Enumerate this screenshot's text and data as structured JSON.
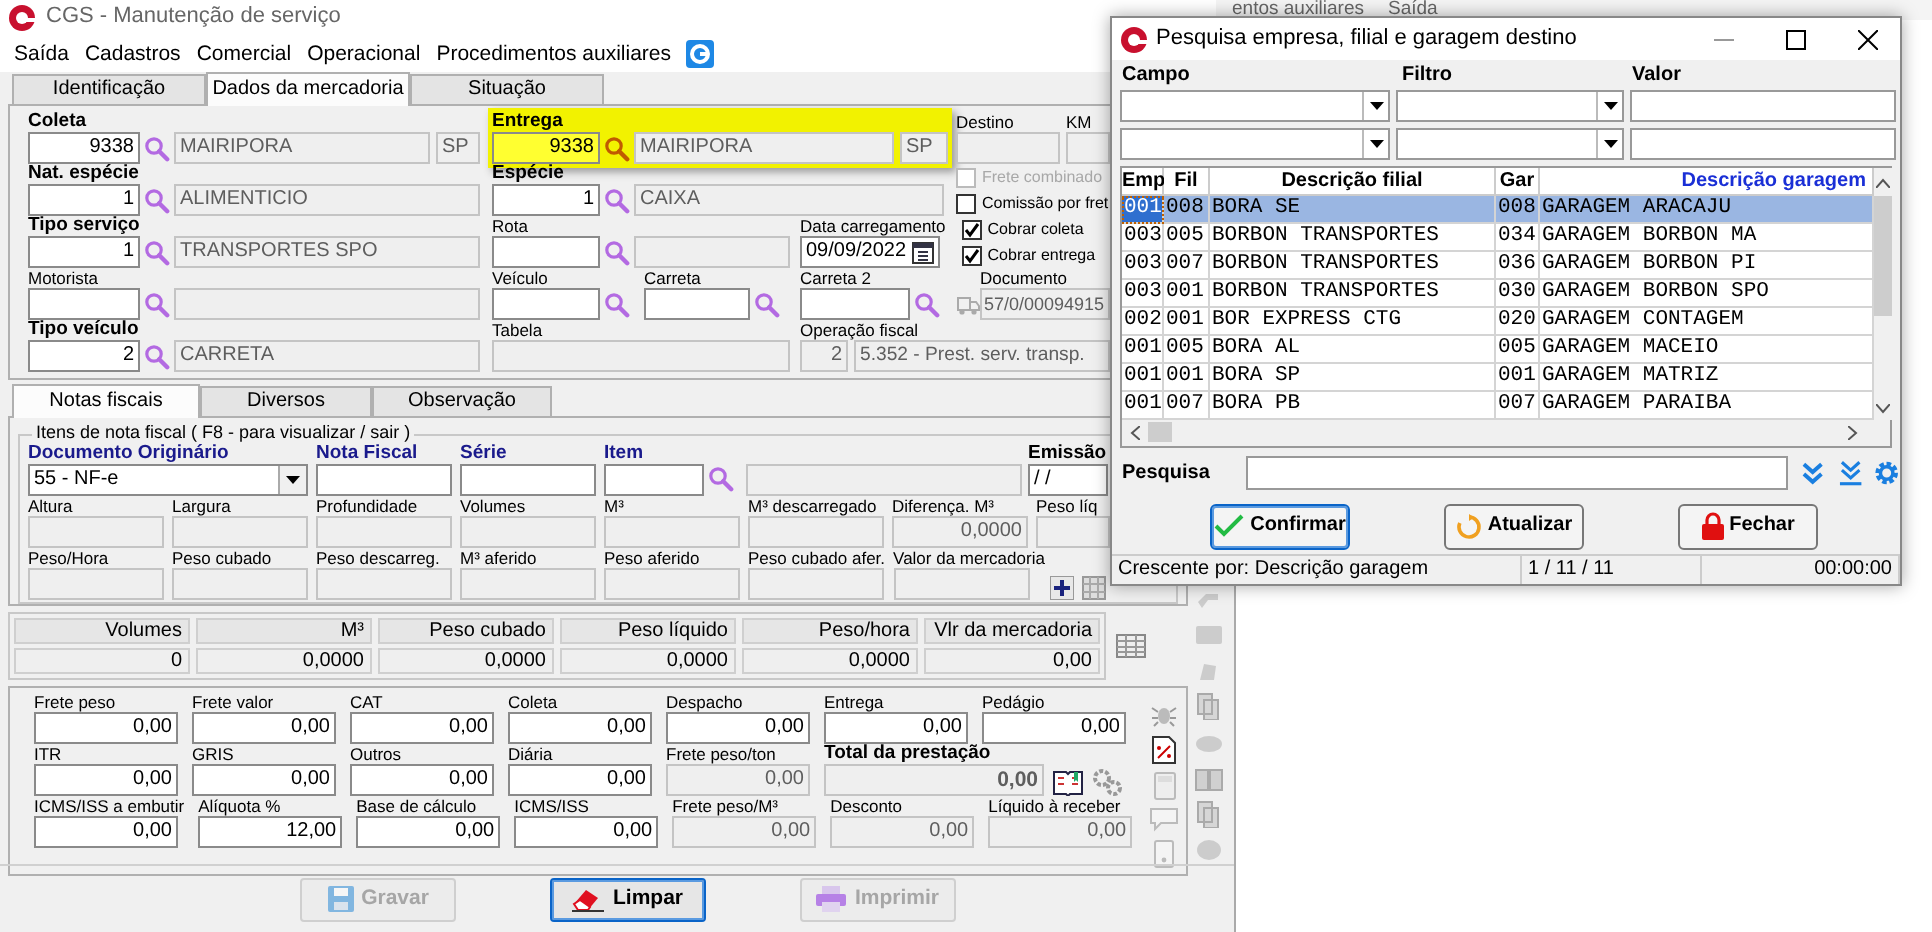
{
  "background_window": {
    "menu": [
      "entos auxiliares",
      "Saída"
    ]
  },
  "window": {
    "title": "CGS - Manutenção de serviço"
  },
  "menu": [
    "Saída",
    "Cadastros",
    "Comercial",
    "Operacional",
    "Procedimentos auxiliares"
  ],
  "tabs": [
    {
      "label": "Identificação",
      "selected": false
    },
    {
      "label": "Dados da mercadoria",
      "selected": true
    },
    {
      "label": "Situação",
      "selected": false
    }
  ],
  "header_form": {
    "rows": [
      {
        "fields": [
          {
            "kind": "lookup",
            "label": "Coleta",
            "label_bold": true,
            "highlighted": false,
            "inputs": [
              {
                "value": "9338",
                "disabled": false
              },
              {
                "value": "MAIRIPORA",
                "disabled": true
              },
              {
                "value": "SP",
                "disabled": true
              }
            ]
          },
          {
            "kind": "lookup",
            "label": "Entrega",
            "label_bold": true,
            "highlighted": true,
            "inputs": [
              {
                "value": "9338",
                "disabled": false
              },
              {
                "value": "MAIRIPORA",
                "disabled": true
              },
              {
                "value": "SP",
                "disabled": true
              }
            ]
          },
          {
            "kind": "input",
            "label": "Destino",
            "label_bold": false,
            "highlighted": false,
            "inputs": [
              {
                "disabled": true
              }
            ]
          },
          {
            "kind": "input",
            "label": "KM",
            "label_bold": false,
            "highlighted": false,
            "inputs": [
              {
                "disabled": true
              }
            ]
          }
        ]
      },
      {
        "fields": [
          {
            "kind": "lookup",
            "label": "Nat. espécie",
            "label_bold": true,
            "highlighted": false,
            "inputs": [
              {
                "value": "1",
                "disabled": false
              },
              {
                "value": "ALIMENTICIO",
                "disabled": true
              }
            ]
          },
          {
            "kind": "lookup",
            "label": "Espécie",
            "label_bold": true,
            "highlighted": false,
            "inputs": [
              {
                "value": "1",
                "disabled": false
              },
              {
                "value": "CAIXA",
                "disabled": true
              }
            ]
          },
          {
            "kind": "checks",
            "items": [
              {
                "label": "Frete combinado",
                "checked": false,
                "disabled": true
              },
              {
                "label": "Comissão por fret",
                "checked": false,
                "disabled": false
              }
            ]
          }
        ]
      },
      {
        "fields": [
          {
            "kind": "lookup",
            "label": "Tipo serviço",
            "label_bold": true,
            "highlighted": false,
            "inputs": [
              {
                "value": "1",
                "disabled": false
              },
              {
                "value": "TRANSPORTES SPO",
                "disabled": true
              }
            ]
          },
          {
            "kind": "lookup",
            "label": "Rota",
            "label_bold": false,
            "highlighted": false,
            "inputs": [
              {
                "disabled": false
              },
              {
                "disabled": true
              }
            ]
          },
          {
            "kind": "date",
            "label": "Data carregamento",
            "label_bold": false,
            "highlighted": false,
            "inputs": [
              {
                "value": "09/09/2022",
                "disabled": false
              }
            ]
          },
          {
            "kind": "checks",
            "items": [
              {
                "label": "Cobrar coleta",
                "checked": true,
                "disabled": false
              },
              {
                "label": "Cobrar entrega",
                "checked": true,
                "disabled": false
              }
            ]
          }
        ]
      },
      {
        "fields": [
          {
            "kind": "lookup",
            "label": "Motorista",
            "label_bold": false,
            "highlighted": false,
            "inputs": [
              {
                "disabled": false
              },
              {
                "disabled": true
              }
            ]
          },
          {
            "kind": "lookup",
            "label": "Veículo",
            "label_bold": false,
            "highlighted": false,
            "inputs": [
              {
                "disabled": false
              }
            ]
          },
          {
            "kind": "lookup",
            "label": "Carreta",
            "label_bold": false,
            "highlighted": false,
            "inputs": [
              {
                "disabled": false
              }
            ]
          },
          {
            "kind": "lookup",
            "label": "Carreta 2",
            "label_bold": false,
            "highlighted": false,
            "inputs": [
              {
                "disabled": false
              }
            ]
          },
          {
            "kind": "document",
            "label": "Documento",
            "label_bold": false,
            "highlighted": false,
            "inputs": [
              {
                "value": "57/0/00094915",
                "disabled": true
              }
            ]
          }
        ]
      },
      {
        "fields": [
          {
            "kind": "lookup",
            "label": "Tipo veículo",
            "label_bold": true,
            "highlighted": false,
            "inputs": [
              {
                "value": "2",
                "disabled": false
              },
              {
                "value": "CARRETA",
                "disabled": true
              }
            ]
          },
          {
            "kind": "input",
            "label": "Tabela",
            "label_bold": false,
            "highlighted": false,
            "inputs": [
              {
                "disabled": true
              }
            ]
          },
          {
            "kind": "input",
            "label": "Operação fiscal",
            "label_bold": false,
            "highlighted": false,
            "inputs": [
              {
                "value": "2",
                "disabled": true
              },
              {
                "value": "5.352 - Prest. serv. transp.",
                "disabled": true
              }
            ]
          }
        ]
      }
    ]
  },
  "item_tabs": [
    {
      "label": "Notas fiscais",
      "selected": true
    },
    {
      "label": "Diversos",
      "selected": false
    },
    {
      "label": "Observação",
      "selected": false
    }
  ],
  "items_group": {
    "title": "Itens de nota fiscal ( F8 - para visualizar / sair )",
    "rows": [
      {
        "fields": [
          {
            "kind": "select",
            "label": "Documento Originário",
            "label_bold": true,
            "label_accent": true,
            "inputs": [
              {
                "value": "55 - NF-e",
                "disabled": false
              }
            ]
          },
          {
            "kind": "input",
            "label": "Nota Fiscal",
            "label_bold": true,
            "label_accent": true,
            "inputs": [
              {
                "disabled": false
              }
            ]
          },
          {
            "kind": "input",
            "label": "Série",
            "label_bold": true,
            "label_accent": true,
            "inputs": [
              {
                "disabled": false
              }
            ]
          },
          {
            "kind": "lookup",
            "label": "Item",
            "label_bold": true,
            "label_accent": true,
            "inputs": [
              {
                "disabled": false
              }
            ]
          },
          {
            "kind": "input",
            "inputs": [
              {
                "disabled": true
              }
            ]
          },
          {
            "kind": "date",
            "label": "Emissão",
            "label_bold": true,
            "label_accent": false,
            "inputs": [
              {
                "value": "/ /",
                "disabled": false
              }
            ]
          }
        ]
      },
      {
        "fields": [
          {
            "kind": "input",
            "label": "Altura",
            "label_bold": false,
            "label_accent": false,
            "inputs": [
              {
                "disabled": true
              }
            ]
          },
          {
            "kind": "input",
            "label": "Largura",
            "label_bold": false,
            "label_accent": false,
            "inputs": [
              {
                "disabled": true
              }
            ]
          },
          {
            "kind": "input",
            "label": "Profundidade",
            "label_bold": false,
            "label_accent": false,
            "inputs": [
              {
                "disabled": true
              }
            ]
          },
          {
            "kind": "input",
            "label": "Volumes",
            "label_bold": false,
            "label_accent": false,
            "inputs": [
              {
                "disabled": true
              }
            ]
          },
          {
            "kind": "input",
            "label": "M³",
            "label_bold": false,
            "label_accent": false,
            "inputs": [
              {
                "disabled": true
              }
            ]
          },
          {
            "kind": "input",
            "label": "M³ descarregado",
            "label_bold": false,
            "label_accent": false,
            "inputs": [
              {
                "disabled": true
              }
            ]
          },
          {
            "kind": "input",
            "label": "Diferença. M³",
            "label_bold": false,
            "label_accent": false,
            "inputs": [
              {
                "value": "0,0000",
                "disabled": true
              }
            ]
          },
          {
            "kind": "input",
            "label": "Peso líq",
            "label_bold": false,
            "label_accent": false,
            "inputs": [
              {
                "disabled": true
              }
            ]
          }
        ]
      },
      {
        "fields": [
          {
            "kind": "input",
            "label": "Peso/Hora",
            "label_bold": false,
            "label_accent": false,
            "inputs": [
              {
                "disabled": true
              }
            ]
          },
          {
            "kind": "input",
            "label": "Peso cubado",
            "label_bold": false,
            "label_accent": false,
            "inputs": [
              {
                "disabled": true
              }
            ]
          },
          {
            "kind": "input",
            "label": "Peso descarreg.",
            "label_bold": false,
            "label_accent": false,
            "inputs": [
              {
                "disabled": true
              }
            ]
          },
          {
            "kind": "input",
            "label": "M³ aferido",
            "label_bold": false,
            "label_accent": false,
            "inputs": [
              {
                "disabled": true
              }
            ]
          },
          {
            "kind": "input",
            "label": "Peso aferido",
            "label_bold": false,
            "label_accent": false,
            "inputs": [
              {
                "disabled": true
              }
            ]
          },
          {
            "kind": "input",
            "label": "Peso cubado afer.",
            "label_bold": false,
            "label_accent": false,
            "inputs": [
              {
                "disabled": true
              }
            ]
          },
          {
            "kind": "input",
            "label": "Valor da mercadoria",
            "label_bold": false,
            "label_accent": false,
            "inputs": [
              {
                "disabled": true
              }
            ]
          }
        ]
      }
    ]
  },
  "summary": [
    {
      "label": "Volumes",
      "value": "0"
    },
    {
      "label": "M³",
      "value": "0,0000"
    },
    {
      "label": "Peso cubado",
      "value": "0,0000"
    },
    {
      "label": "Peso líquido",
      "value": "0,0000"
    },
    {
      "label": "Peso/hora",
      "value": "0,0000"
    },
    {
      "label": "Vlr da mercadoria",
      "value": "0,00"
    }
  ],
  "charges": {
    "rows": [
      {
        "fields": [
          {
            "kind": "input",
            "label": "Frete peso",
            "label_bold": false,
            "inputs": [
              {
                "value": "0,00",
                "disabled": false
              }
            ]
          },
          {
            "kind": "input",
            "label": "Frete valor",
            "label_bold": false,
            "inputs": [
              {
                "value": "0,00",
                "disabled": false
              }
            ]
          },
          {
            "kind": "input",
            "label": "CAT",
            "label_bold": false,
            "inputs": [
              {
                "value": "0,00",
                "disabled": false
              }
            ]
          },
          {
            "kind": "input",
            "label": "Coleta",
            "label_bold": false,
            "inputs": [
              {
                "value": "0,00",
                "disabled": false
              }
            ]
          },
          {
            "kind": "input",
            "label": "Despacho",
            "label_bold": false,
            "inputs": [
              {
                "value": "0,00",
                "disabled": false
              }
            ]
          },
          {
            "kind": "input",
            "label": "Entrega",
            "label_bold": false,
            "inputs": [
              {
                "value": "0,00",
                "disabled": false
              }
            ]
          },
          {
            "kind": "input",
            "label": "Pedágio",
            "label_bold": false,
            "inputs": [
              {
                "value": "0,00",
                "disabled": false
              }
            ]
          }
        ]
      },
      {
        "fields": [
          {
            "kind": "input",
            "label": "ITR",
            "label_bold": false,
            "inputs": [
              {
                "value": "0,00",
                "disabled": false
              }
            ]
          },
          {
            "kind": "input",
            "label": "GRIS",
            "label_bold": false,
            "inputs": [
              {
                "value": "0,00",
                "disabled": false
              }
            ]
          },
          {
            "kind": "input",
            "label": "Outros",
            "label_bold": false,
            "inputs": [
              {
                "value": "0,00",
                "disabled": false
              }
            ]
          },
          {
            "kind": "input",
            "label": "Diária",
            "label_bold": false,
            "inputs": [
              {
                "value": "0,00",
                "disabled": false
              }
            ]
          },
          {
            "kind": "input",
            "label": "Frete peso/ton",
            "label_bold": false,
            "inputs": [
              {
                "value": "0,00",
                "disabled": true
              }
            ]
          },
          {
            "kind": "total",
            "label": "Total da prestação",
            "label_bold": true,
            "inputs": [
              {
                "value": "0,00",
                "disabled": true
              }
            ]
          }
        ]
      },
      {
        "fields": [
          {
            "kind": "input",
            "label": "ICMS/ISS a embutir",
            "label_bold": false,
            "inputs": [
              {
                "value": "0,00",
                "disabled": false
              }
            ]
          },
          {
            "kind": "input",
            "label": "Alíquota %",
            "label_bold": false,
            "inputs": [
              {
                "value": "12,00",
                "disabled": false
              }
            ]
          },
          {
            "kind": "input",
            "label": "Base de cálculo",
            "label_bold": false,
            "inputs": [
              {
                "value": "0,00",
                "disabled": false
              }
            ]
          },
          {
            "kind": "input",
            "label": "ICMS/ISS",
            "label_bold": false,
            "inputs": [
              {
                "value": "0,00",
                "disabled": false
              }
            ]
          },
          {
            "kind": "input",
            "label": "Frete peso/M³",
            "label_bold": false,
            "inputs": [
              {
                "value": "0,00",
                "disabled": true
              }
            ]
          },
          {
            "kind": "input",
            "label": "Desconto",
            "label_bold": false,
            "inputs": [
              {
                "value": "0,00",
                "disabled": true
              }
            ]
          },
          {
            "kind": "input",
            "label": "Líquido à receber",
            "label_bold": false,
            "inputs": [
              {
                "value": "0,00",
                "disabled": true
              }
            ]
          }
        ]
      }
    ]
  },
  "buttons": [
    {
      "kind": "save",
      "label": "Gravar",
      "disabled": true,
      "focused": false
    },
    {
      "kind": "clear",
      "label": "Limpar",
      "disabled": false,
      "focused": true
    },
    {
      "kind": "print",
      "label": "Imprimir",
      "disabled": true,
      "focused": false
    }
  ],
  "dialog": {
    "title": "Pesquisa empresa, filial e garagem destino",
    "filter_labels": [
      "Campo",
      "Filtro",
      "Valor"
    ],
    "filter_rows": [
      {
        "kind": "filter"
      },
      {
        "kind": "filter"
      }
    ],
    "grid": {
      "columns": [
        {
          "label": "Emp",
          "sorted": false
        },
        {
          "label": "Fil",
          "sorted": false
        },
        {
          "label": "Descrição filial",
          "sorted": false
        },
        {
          "label": "Gar",
          "sorted": false
        },
        {
          "label": "Descrição garagem",
          "sorted": true
        }
      ],
      "rows": [
        {
          "cells": [
            "001",
            "008",
            "BORA SE",
            "008",
            "GARAGEM ARACAJU"
          ],
          "selected": true
        },
        {
          "cells": [
            "003",
            "005",
            "BORBON TRANSPORTES",
            "034",
            "GARAGEM BORBON MA"
          ],
          "selected": false
        },
        {
          "cells": [
            "003",
            "007",
            "BORBON TRANSPORTES",
            "036",
            "GARAGEM BORBON PI"
          ],
          "selected": false
        },
        {
          "cells": [
            "003",
            "001",
            "BORBON TRANSPORTES",
            "030",
            "GARAGEM BORBON SPO"
          ],
          "selected": false
        },
        {
          "cells": [
            "002",
            "001",
            "BOR EXPRESS CTG",
            "020",
            "GARAGEM CONTAGEM"
          ],
          "selected": false
        },
        {
          "cells": [
            "001",
            "005",
            "BORA AL",
            "005",
            "GARAGEM MACEIO"
          ],
          "selected": false
        },
        {
          "cells": [
            "001",
            "001",
            "BORA SP",
            "001",
            "GARAGEM MATRIZ"
          ],
          "selected": false
        },
        {
          "cells": [
            "001",
            "007",
            "BORA PB",
            "007",
            "GARAGEM PARAIBA"
          ],
          "selected": false
        }
      ]
    },
    "search_label": "Pesquisa",
    "buttons": [
      {
        "kind": "confirm",
        "label": "Confirmar",
        "focused": true
      },
      {
        "kind": "refresh",
        "label": "Atualizar",
        "focused": false
      },
      {
        "kind": "close",
        "label": "Fechar",
        "focused": false
      }
    ],
    "status": [
      "Crescente por: Descrição garagem",
      "1 / 11 / 11",
      "00:00:00"
    ]
  }
}
